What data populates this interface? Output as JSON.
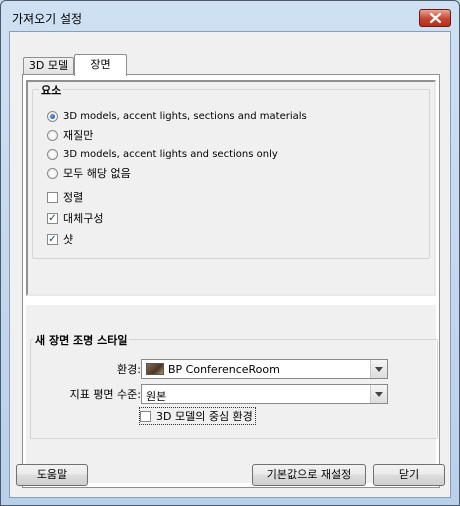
{
  "window": {
    "title": "가져오기 설정"
  },
  "tabs": [
    {
      "label": "3D 모델",
      "active": false
    },
    {
      "label": "장면",
      "active": true
    }
  ],
  "elements_group": {
    "legend": "요소",
    "radio_options": [
      {
        "label": "3D models, accent lights, sections and materials",
        "selected": true
      },
      {
        "label": "재질만",
        "selected": false
      },
      {
        "label": "3D models, accent lights and sections only",
        "selected": false
      },
      {
        "label": "모두 해당 없음",
        "selected": false
      }
    ],
    "checkboxes": [
      {
        "label": "정렬",
        "checked": false
      },
      {
        "label": "대체구성",
        "checked": true
      },
      {
        "label": "샷",
        "checked": true
      }
    ]
  },
  "lighting_group": {
    "legend": "새 장면 조명 스타일",
    "environment_label": "환경:",
    "environment_value": "BP ConferenceRoom",
    "ground_plane_label": "지표 평면 수준:",
    "ground_plane_value": "원본",
    "center_checkbox_label": "3D 모델의 중심 환경",
    "center_checkbox_checked": false
  },
  "buttons": {
    "help": "도움말",
    "reset": "기본값으로 재설정",
    "close": "닫기"
  },
  "colors": {
    "title_bar": "#c9dbee",
    "close_button": "#c7442f",
    "radio_selected": "#1b4aa8"
  }
}
